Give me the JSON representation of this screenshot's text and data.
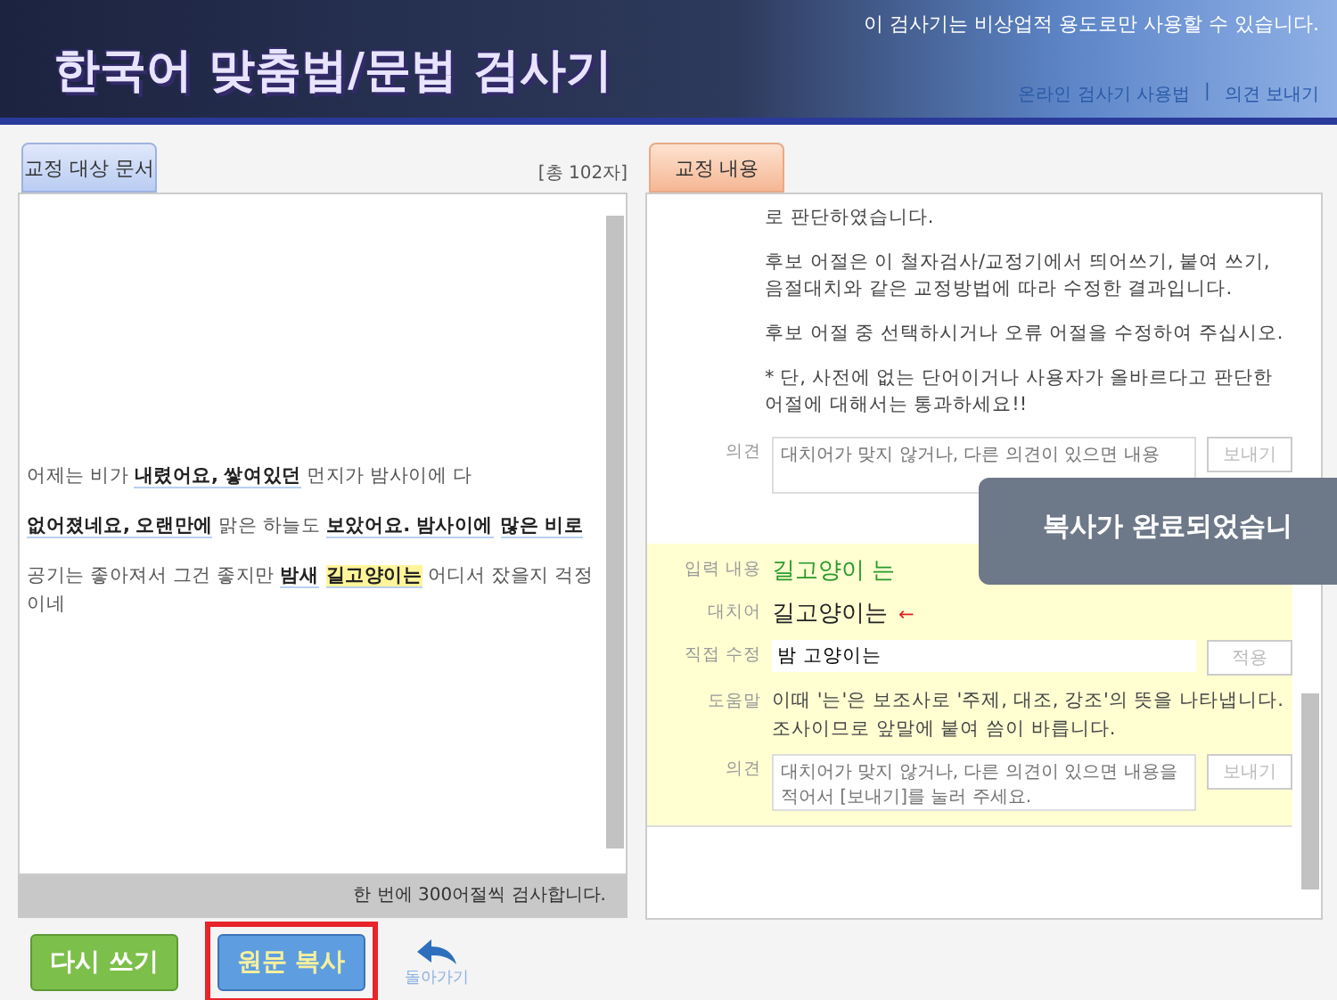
{
  "header": {
    "title": "한국어 맞춤법/문법 검사기",
    "notice": "이 검사기는 비상업적 용도로만 사용할 수 있습니다.",
    "links": [
      "온라인 검사기 사용법",
      "의견 보내기"
    ],
    "separator": "|"
  },
  "source_panel": {
    "tab": "교정 대상 문서",
    "count": "[총 102자]",
    "lines": [
      [
        {
          "kind": "plain",
          "text": "어제는 비가 "
        },
        {
          "kind": "error",
          "text": "내렸어요, 쌓여있던",
          "selected": false
        },
        {
          "kind": "plain",
          "text": " 먼지가 밤사이에 다"
        }
      ],
      [
        {
          "kind": "error",
          "text": "없어졌네요, 오랜만에",
          "selected": false
        },
        {
          "kind": "plain",
          "text": " 맑은 하늘도 "
        },
        {
          "kind": "error",
          "text": "보았어요. 밤사이에",
          "selected": false
        },
        {
          "kind": "error",
          "text": "많은 비로",
          "selected": false
        }
      ],
      [
        {
          "kind": "plain",
          "text": "공기는 좋아져서 그건 좋지만 "
        },
        {
          "kind": "error",
          "text": "밤새",
          "selected": false
        },
        {
          "kind": "error",
          "text": "길고양이는",
          "selected": true
        },
        {
          "kind": "plain",
          "text": " 어디서 잤을지 걱정이네"
        }
      ]
    ],
    "footer": "한 번에 300어절씩 검사합니다."
  },
  "buttons": [
    {
      "kind": "green",
      "label": "다시 쓰기",
      "highlighted": false
    },
    {
      "kind": "blue",
      "label": "원문 복사",
      "highlighted": true
    },
    {
      "kind": "back",
      "label": "돌아가기",
      "highlighted": false
    }
  ],
  "result_panel": {
    "tab": "교정 내용",
    "paragraphs": [
      "로 판단하였습니다.",
      "후보 어절은 이 철자검사/교정기에서 띄어쓰기, 붙여 쓰기, 음절대치와 같은 교정방법에 따라 수정한 결과입니다.",
      "후보 어절 중 선택하시거나 오류 어절을 수정하여 주십시오.",
      "* 단, 사전에 없는 단어이거나 사용자가 올바르다고 판단한 어절에 대해서는 통과하세요!!"
    ],
    "opinion_label": "의견",
    "opinion_placeholder": "대치어가 맞지 않거나, 다른 의견이 있으면 내용",
    "send_button": "보내기",
    "item": {
      "input_label": "입력 내용",
      "input": "길고양이 는",
      "replacement_label": "대치어",
      "replacement": "길고양이는",
      "arrow": "←",
      "edit_label": "직접 수정",
      "edit_value": "밤 고양이는",
      "apply_button": "적용",
      "help_label": "도움말",
      "help": "이때 '는'은 보조사로 '주제, 대조, 강조'의 뜻을 나타냅니다. 조사이므로 앞말에 붙여 씀이 바릅니다.",
      "opinion_label": "의견",
      "opinion_placeholder": "대치어가 맞지 않거나, 다른 의견이 있으면 내용을 적어서 [보내기]를 눌러 주세요.",
      "send_button": "보내기"
    }
  },
  "toast": "복사가 완료되었습니"
}
